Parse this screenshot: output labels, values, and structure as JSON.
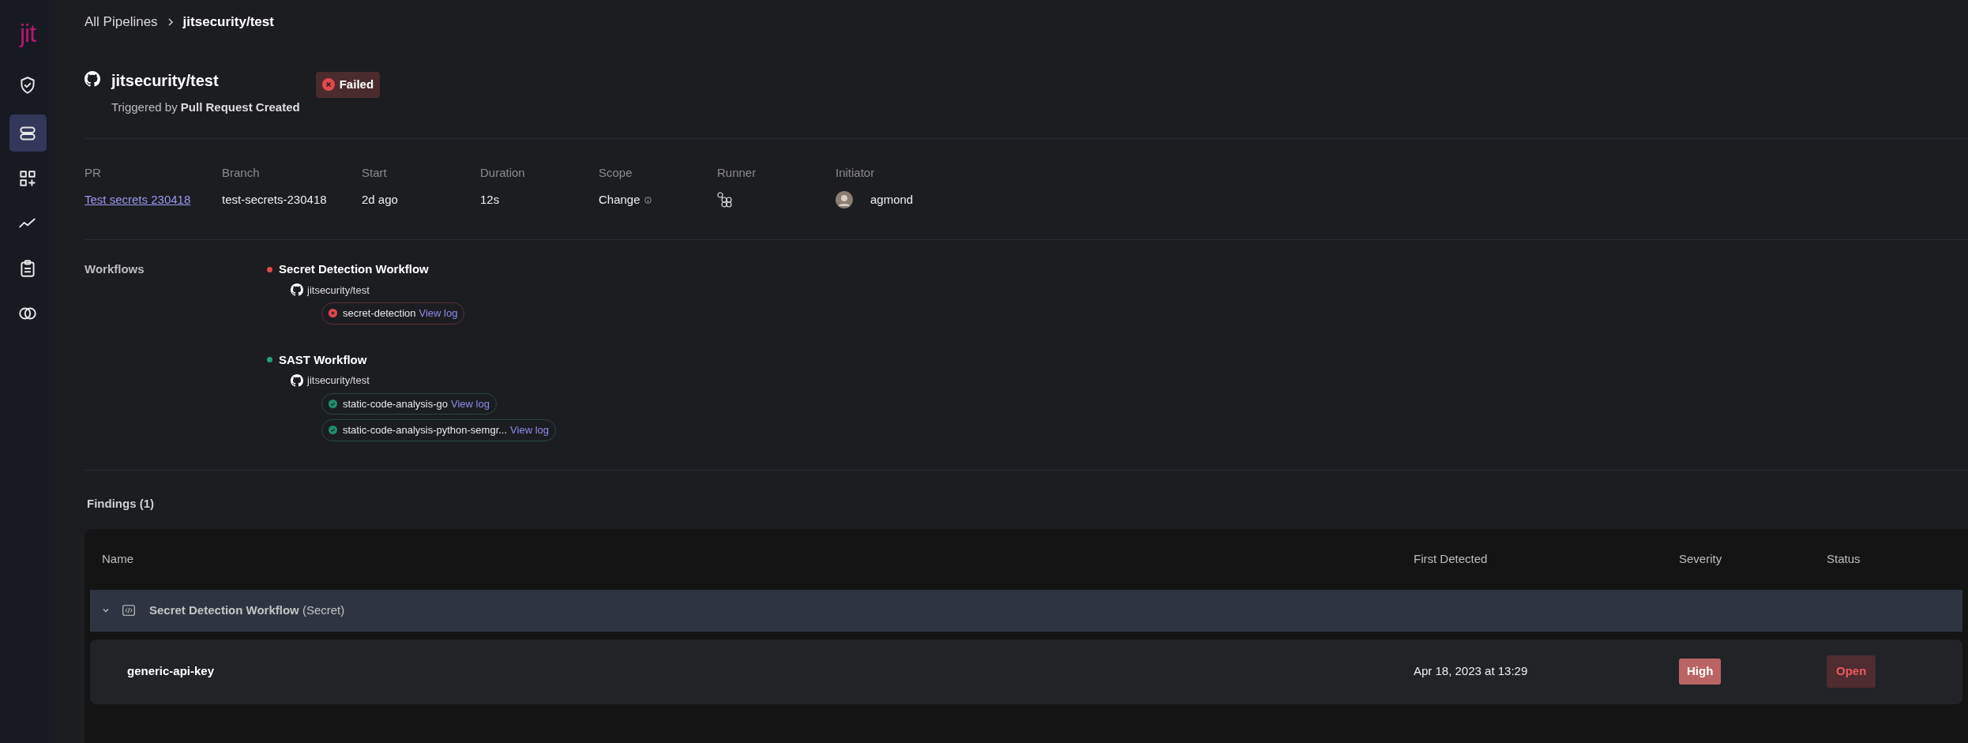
{
  "sidebar": {
    "logo": "jit",
    "items": [
      {
        "selected": false
      },
      {
        "selected": true
      },
      {
        "selected": false
      },
      {
        "selected": false
      },
      {
        "selected": false
      },
      {
        "selected": false
      }
    ]
  },
  "breadcrumb": [
    "All Pipelines",
    "jitsecurity/test"
  ],
  "header": {
    "repo": "jitsecurity/test",
    "status": "Failed",
    "failed": true,
    "trigger": "Triggered by **Pull Request Created**"
  },
  "details": [
    {
      "kind": "link",
      "label": "PR",
      "value": "Test secrets 230418"
    },
    {
      "kind": "text",
      "label": "Branch",
      "value": "test-secrets-230418"
    },
    {
      "kind": "text",
      "label": "Start",
      "value": "2d ago"
    },
    {
      "kind": "text",
      "label": "Duration",
      "value": "12s"
    },
    {
      "kind": "info",
      "label": "Scope",
      "value": "Change"
    },
    {
      "kind": "runner",
      "label": "Runner"
    },
    {
      "kind": "user",
      "label": "Initiator",
      "value": "agmond"
    }
  ],
  "workflows": {
    "label": "Workflows",
    "items": [
      {
        "name": "Secret Detection Workflow",
        "failed": true,
        "repo": "jitsecurity/test",
        "jobs": [
          {
            "name": "secret-detection",
            "failed": true,
            "link": "View log"
          }
        ]
      },
      {
        "name": "SAST Workflow",
        "failed": false,
        "repo": "jitsecurity/test",
        "jobs": [
          {
            "name": "static-code-analysis-go",
            "failed": false,
            "link": "View log"
          },
          {
            "name": "static-code-analysis-python-semgr...",
            "failed": false,
            "link": "View log"
          }
        ]
      }
    ]
  },
  "findings": {
    "title": "Findings (1)",
    "columns": [
      "Name",
      "First Detected",
      "Severity",
      "Status"
    ],
    "groups": [
      {
        "name": "Secret Detection Workflow",
        "type": "(Secret)",
        "expanded": true,
        "rows": [
          {
            "name": "generic-api-key",
            "first_detected": "Apr 18, 2023 at 13:29",
            "severity": "High",
            "status": "Open"
          }
        ]
      }
    ]
  }
}
